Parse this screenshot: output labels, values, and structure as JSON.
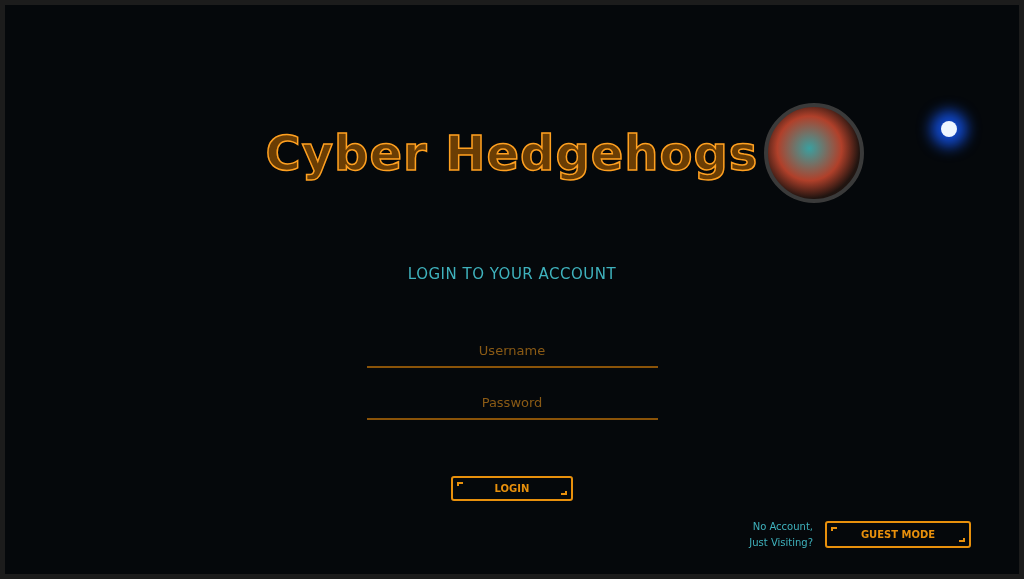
{
  "app_title": "Cyber Hedgehogs",
  "heading": "LOGIN TO YOUR ACCOUNT",
  "fields": [
    {
      "placeholder": "Username"
    },
    {
      "placeholder": "Password"
    }
  ],
  "login_button": "LOGIN",
  "guest": {
    "prompt_lines": [
      "No Account,",
      "Just Visiting?"
    ],
    "button": "GUEST MODE"
  }
}
